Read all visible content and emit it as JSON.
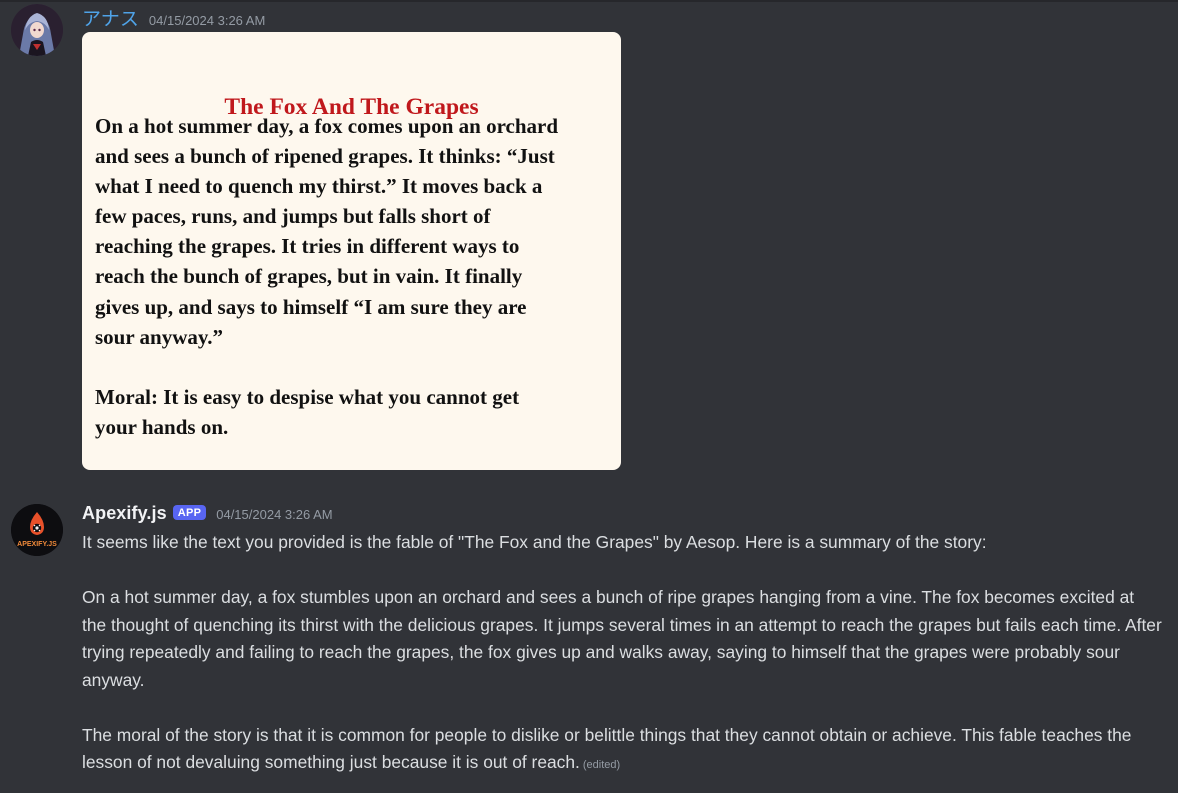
{
  "messages": [
    {
      "author": "アナス",
      "timestamp": "04/15/2024 3:26 AM",
      "attachment": {
        "title": "The Fox And The Grapes",
        "body_lines": [
          "On a hot summer day, a fox comes upon an orchard",
          "and sees a bunch of ripened grapes. It thinks: “Just",
          "what I need to quench my thirst.” It moves back a",
          "few paces, runs, and jumps but falls short of",
          "reaching the grapes. It tries in different ways to",
          "reach the bunch of grapes, but in vain. It finally",
          "gives up, and says to himself “I am sure they are",
          "sour anyway.”"
        ],
        "moral_lines": [
          "Moral: It is easy to despise what you cannot get",
          "your hands on."
        ]
      }
    },
    {
      "author": "Apexify.js",
      "badge": "APP",
      "timestamp": "04/15/2024 3:26 AM",
      "avatar_text": "APEXIFY.JS",
      "paragraphs": [
        "It seems like the text you provided is the fable of \"The Fox and the Grapes\" by Aesop. Here is a summary of the story:",
        "On a hot summer day, a fox stumbles upon an orchard and sees a bunch of ripe grapes hanging from a vine. The fox becomes excited at the thought of quenching its thirst with the delicious grapes. It jumps several times in an attempt to reach the grapes but fails each time. After trying repeatedly and failing to reach the grapes, the fox gives up and walks away, saying to himself that the grapes were probably sour anyway.",
        "The moral of the story is that it is common for people to dislike or belittle things that they cannot obtain or achieve. This fable teaches the lesson of not devaluing something just because it is out of reach."
      ],
      "edited_label": "(edited)"
    }
  ],
  "colors": {
    "background": "#313338",
    "username_1": "#4fa3e8",
    "username_2": "#f2f3f5",
    "badge": "#5865f2",
    "fable_title": "#c0181c",
    "attachment_bg": "#fef8ee"
  },
  "icons": {
    "avatar_1": "anime-character-avatar",
    "avatar_2": "apexify-flame-logo"
  }
}
